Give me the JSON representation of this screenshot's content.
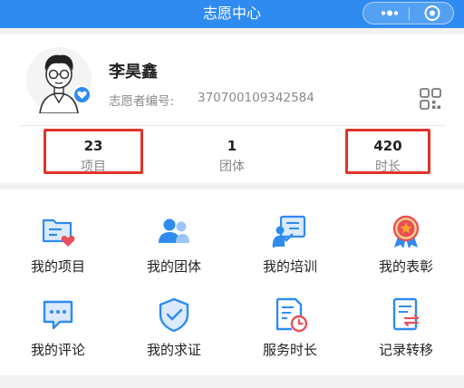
{
  "header": {
    "title": "志愿中心",
    "more_icon": "more-dots-icon",
    "target_icon": "target-circle-icon"
  },
  "profile": {
    "name": "李昊鑫",
    "volunteer_id_label": "志愿者编号:",
    "volunteer_id": "370700109342584",
    "avatar_icon": "avatar-cartoon",
    "badge_icon": "heart-badge-icon",
    "qr_icon": "qr-code-icon"
  },
  "stats": [
    {
      "value": "23",
      "label": "项目",
      "highlighted": true
    },
    {
      "value": "1",
      "label": "团体",
      "highlighted": false
    },
    {
      "value": "420",
      "label": "时长",
      "highlighted": true
    }
  ],
  "menu": [
    {
      "label": "我的项目",
      "icon": "folder-heart-icon"
    },
    {
      "label": "我的团体",
      "icon": "group-people-icon"
    },
    {
      "label": "我的培训",
      "icon": "training-board-icon"
    },
    {
      "label": "我的表彰",
      "icon": "medal-star-icon"
    },
    {
      "label": "我的评论",
      "icon": "comment-bubble-icon"
    },
    {
      "label": "我的求证",
      "icon": "shield-check-icon"
    },
    {
      "label": "服务时长",
      "icon": "document-clock-icon"
    },
    {
      "label": "记录转移",
      "icon": "transfer-doc-icon"
    }
  ],
  "colors": {
    "brand": "#2f8bf0",
    "highlight": "#e03428",
    "accent_red": "#e8505b",
    "accent_orange": "#f5a623"
  }
}
